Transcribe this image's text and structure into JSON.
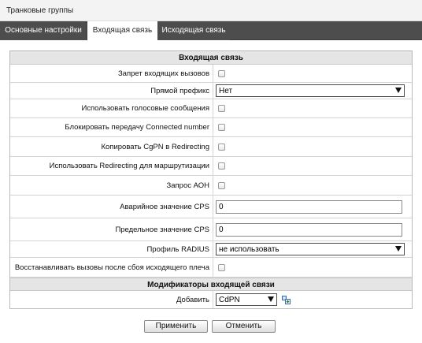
{
  "page": {
    "title": "Транковые группы"
  },
  "tabs": [
    {
      "label": "Основные настройки"
    },
    {
      "label": "Входящая связь"
    },
    {
      "label": "Исходящая связь"
    }
  ],
  "incoming": {
    "section_title": "Входящая связь",
    "rows": [
      {
        "label": "Запрет входящих вызовов",
        "type": "checkbox",
        "checked": false
      },
      {
        "label": "Прямой префикс",
        "type": "select",
        "value": "Нет"
      },
      {
        "label": "Использовать голосовые сообщения",
        "type": "checkbox",
        "checked": false
      },
      {
        "label": "Блокировать передачу Connected number",
        "type": "checkbox",
        "checked": false
      },
      {
        "label": "Копировать CgPN в Redirecting",
        "type": "checkbox",
        "checked": false
      },
      {
        "label": "Использовать Redirecting для маршрутизации",
        "type": "checkbox",
        "checked": false
      },
      {
        "label": "Запрос АОН",
        "type": "checkbox",
        "checked": false
      },
      {
        "label": "Аварийное значение CPS",
        "type": "text",
        "value": "0"
      },
      {
        "label": "Предельное значение CPS",
        "type": "text",
        "value": "0"
      },
      {
        "label": "Профиль RADIUS",
        "type": "select",
        "value": "не использовать"
      },
      {
        "label": "Восстанавливать вызовы после сбоя исходящего плеча",
        "type": "checkbox",
        "checked": false
      }
    ]
  },
  "modifiers": {
    "section_title": "Модификаторы входящей связи",
    "add_label": "Добавить",
    "add_select_value": "CdPN"
  },
  "buttons": {
    "apply": "Применить",
    "cancel": "Отменить"
  }
}
